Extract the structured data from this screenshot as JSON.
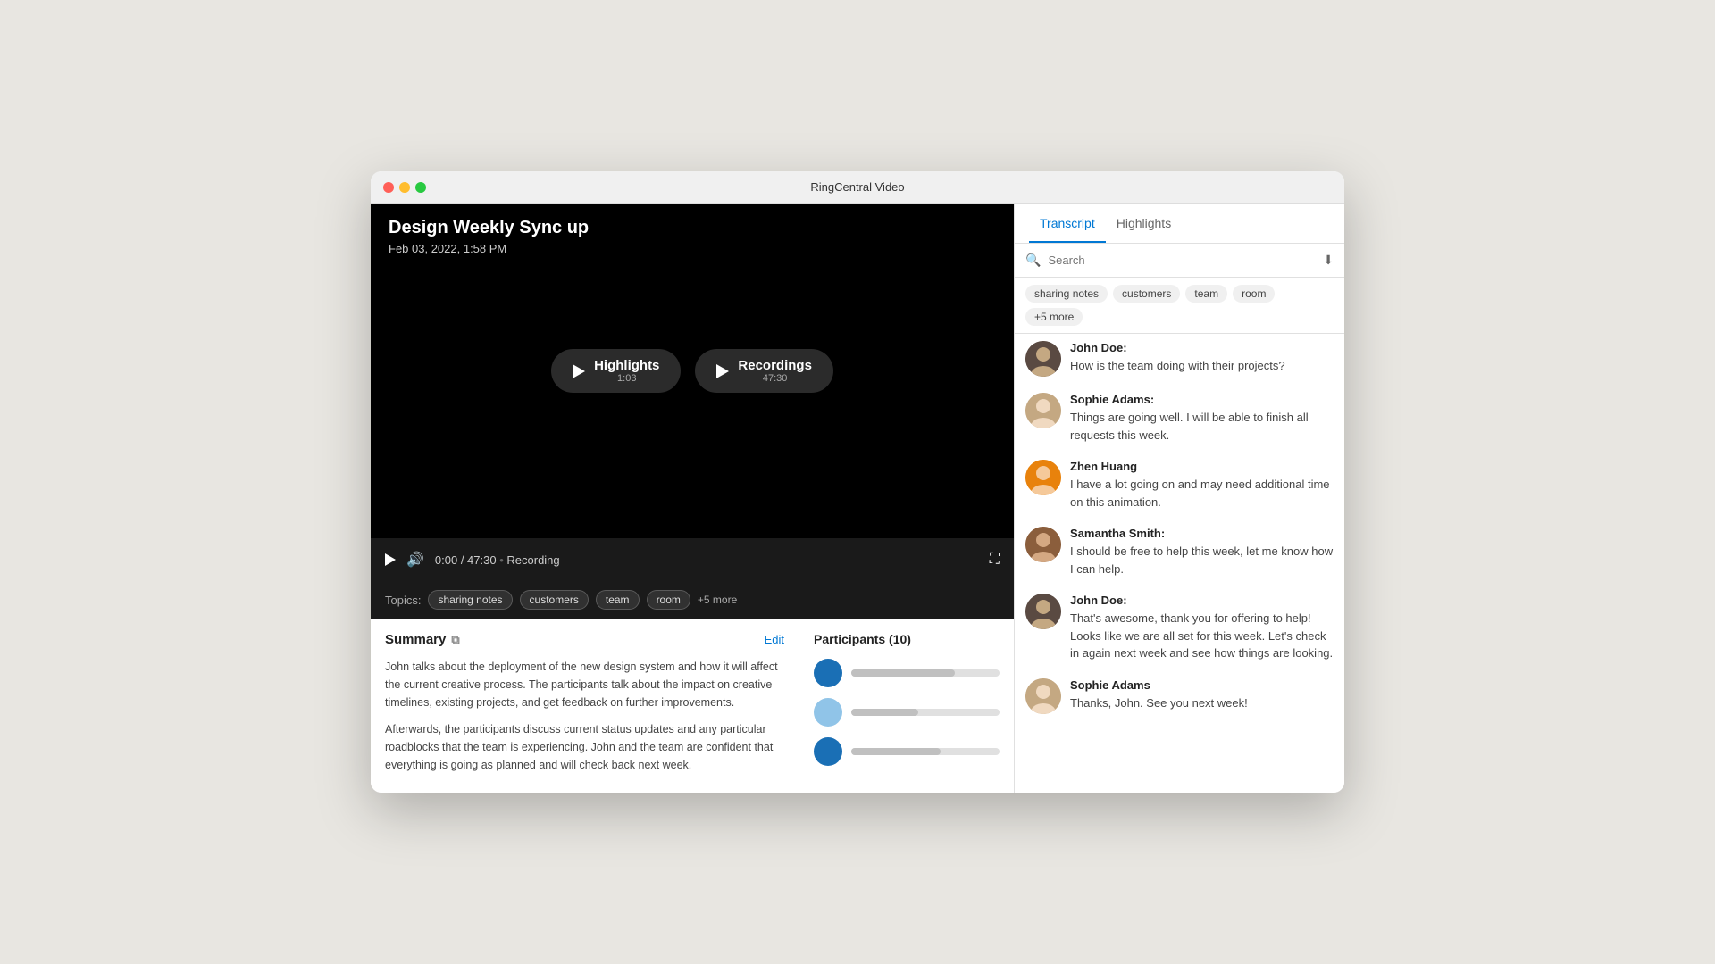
{
  "titlebar": {
    "title": "RingCentral Video"
  },
  "video": {
    "title": "Design Weekly Sync up",
    "date": "Feb 03, 2022, 1:58 PM",
    "highlights_label": "Highlights",
    "highlights_duration": "1:03",
    "recordings_label": "Recordings",
    "recordings_duration": "47:30",
    "time": "0:00 / 47:30",
    "recording_label": "Recording"
  },
  "topics": {
    "label": "Topics:",
    "tags": [
      "sharing notes",
      "customers",
      "team",
      "room"
    ],
    "more": "+5 more"
  },
  "summary": {
    "title": "Summary",
    "edit_label": "Edit",
    "paragraph1": "John talks about the deployment of the new design system and how it will affect the current creative process. The participants talk about the impact on creative timelines, existing projects, and get feedback on further improvements.",
    "paragraph2": "Afterwards, the participants discuss current status updates and any particular roadblocks that the team is experiencing. John and the team are confident that everything is going as planned and will check back next week."
  },
  "participants": {
    "title": "Participants (10)",
    "items": [
      {
        "color": "#1a6fb5",
        "bar_width": "70%"
      },
      {
        "color": "#90c4e8",
        "bar_width": "45%"
      },
      {
        "color": "#1a6fb5",
        "bar_width": "60%"
      }
    ]
  },
  "transcript": {
    "tab_transcript": "Transcript",
    "tab_highlights": "Highlights",
    "search_placeholder": "Search",
    "tags": [
      "sharing notes",
      "customers",
      "team",
      "room",
      "+5 more"
    ],
    "messages": [
      {
        "name": "John Doe:",
        "text": "How is the team doing with their projects?",
        "avatar_color": "#5a4a42"
      },
      {
        "name": "Sophie Adams:",
        "text": "Things are going well. I will be able to finish all requests this week.",
        "avatar_color": "#c4a882"
      },
      {
        "name": "Zhen Huang",
        "text": "I have a lot going on and may need additional time on this animation.",
        "avatar_color": "#e8820c"
      },
      {
        "name": "Samantha Smith:",
        "text": "I should be free to help this week, let me know how I can help.",
        "avatar_color": "#8b5e3c"
      },
      {
        "name": "John Doe:",
        "text": "That's awesome, thank you for offering to help! Looks like we are all set for this week. Let's check in again next week and see how things are looking.",
        "avatar_color": "#5a4a42"
      },
      {
        "name": "Sophie Adams",
        "text": "Thanks, John. See you next week!",
        "avatar_color": "#c4a882"
      }
    ]
  }
}
